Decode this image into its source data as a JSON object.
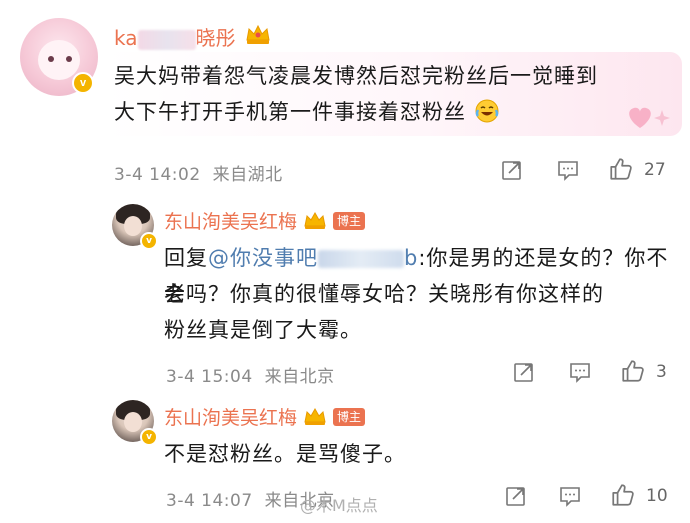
{
  "comment_main": {
    "username_prefix": "ka",
    "username_suffix": "晓彤",
    "text_line1": "吴大妈带着怨气凌晨发博然后怼完粉丝后一觉睡到",
    "text_line2": "大下午打开手机第一件事接着怼粉丝",
    "emoji_icon": "laughing-crying-emoji",
    "time": "3-4 14:02",
    "location": "来自湖北",
    "like_count": "27"
  },
  "reply_1": {
    "username": "东山洵美吴红梅",
    "host_badge": "博主",
    "reply_prefix": "回复",
    "mention_prefix": "@你没事吧",
    "mention_suffix": "b",
    "text_after_mention": ":你是男的还是女的？你不会",
    "text_line2": "老吗？你真的很懂辱女哈？关晓彤有你这样的",
    "text_line3": "粉丝真是倒了大霉。",
    "time": "3-4 15:04",
    "location": "来自北京",
    "like_count": "3"
  },
  "reply_2": {
    "username": "东山洵美吴红梅",
    "host_badge": "博主",
    "text": "不是怼粉丝。是骂傻子。",
    "time": "3-4 14:07",
    "location": "来自北京",
    "like_count": "10"
  },
  "watermark": "@木M点点",
  "colors": {
    "username": "#eb7350",
    "mention": "#507daf",
    "meta": "#8a8a8a",
    "host_badge_bg": "#eb7350",
    "verified_badge": "#f4b400"
  }
}
